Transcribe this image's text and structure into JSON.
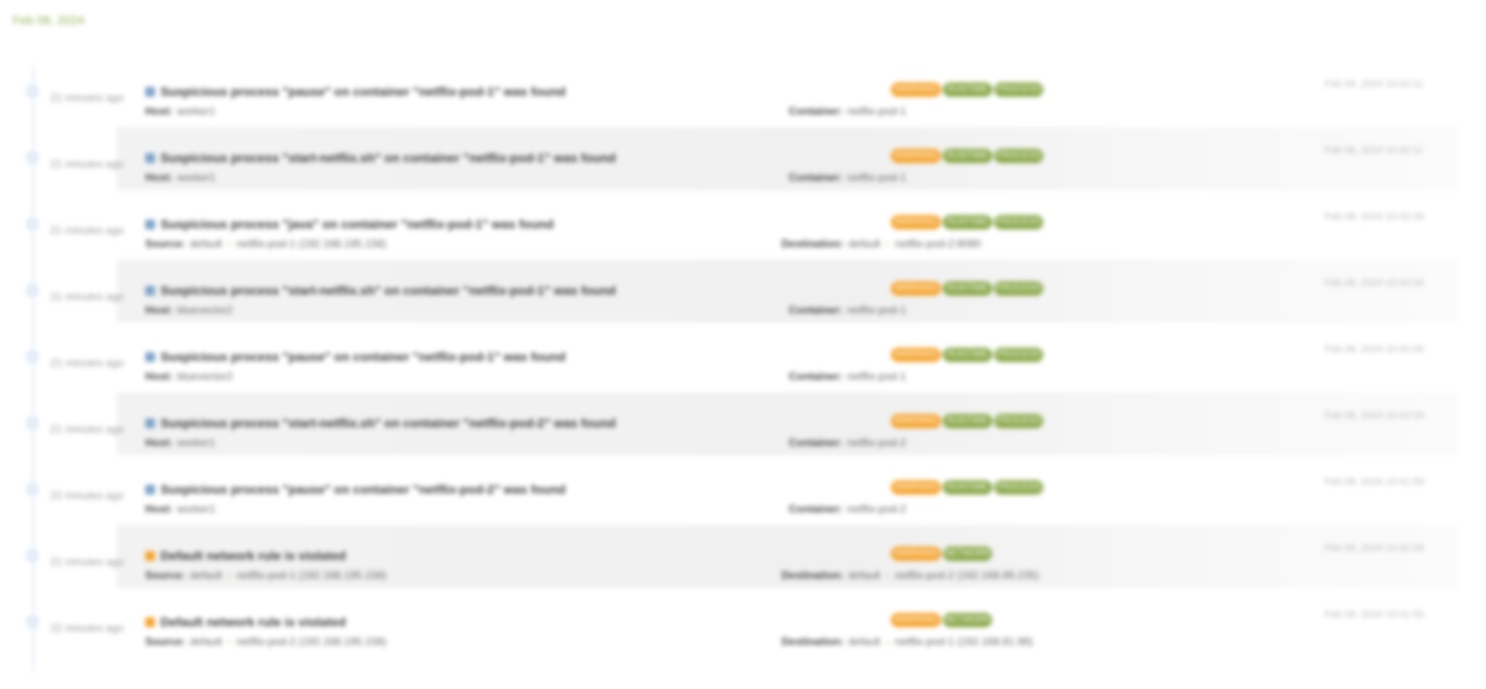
{
  "header": {
    "date": "Feb 08, 2024"
  },
  "colors": {
    "accent_green": "#8aa84a",
    "accent_orange": "#f5a531",
    "timeline": "#dfe9f5"
  },
  "events": [
    {
      "time_ago": "21 minutes ago",
      "icon": "process-icon",
      "title": "Suspicious process \"pause\" on container \"netflix-pod-1\" was found",
      "sub_label": "Host:",
      "sub_value": "worker1",
      "sub_target": "",
      "dest_label": "Container:",
      "dest_value": "netflix-pod-1",
      "dest_target": "",
      "tags": [
        {
          "text": "WARNING",
          "color": "orange"
        },
        {
          "text": "RUNTIME",
          "color": "green"
        },
        {
          "text": "PROCESS",
          "color": "green"
        }
      ],
      "timestamp": "Feb 08, 2024 10:42:11"
    },
    {
      "time_ago": "21 minutes ago",
      "icon": "process-icon",
      "title": "Suspicious process \"start-netflix.sh\" on container \"netflix-pod-1\" was found",
      "sub_label": "Host:",
      "sub_value": "worker1",
      "sub_target": "",
      "dest_label": "Container:",
      "dest_value": "netflix-pod-1",
      "dest_target": "",
      "tags": [
        {
          "text": "WARNING",
          "color": "orange"
        },
        {
          "text": "RUNTIME",
          "color": "green"
        },
        {
          "text": "PROCESS",
          "color": "green"
        }
      ],
      "timestamp": "Feb 08, 2024 10:42:11"
    },
    {
      "time_ago": "21 minutes ago",
      "icon": "process-icon",
      "title": "Suspicious process \"java\" on container \"netflix-pod-1\" was found",
      "sub_label": "Source:",
      "sub_value": "default",
      "sub_target": "netflix-pod-1 (192.168.195.158)",
      "dest_label": "Destination:",
      "dest_value": "default",
      "dest_target": "netflix-pod-2:8080",
      "tags": [
        {
          "text": "WARNING",
          "color": "orange"
        },
        {
          "text": "RUNTIME",
          "color": "green"
        },
        {
          "text": "PROCESS",
          "color": "green"
        }
      ],
      "timestamp": "Feb 08, 2024 10:42:09"
    },
    {
      "time_ago": "21 minutes ago",
      "icon": "process-icon",
      "title": "Suspicious process \"start-netflix.sh\" on container \"netflix-pod-1\" was found",
      "sub_label": "Host:",
      "sub_value": "bluevector2",
      "sub_target": "",
      "dest_label": "Container:",
      "dest_value": "netflix-pod-1",
      "dest_target": "",
      "tags": [
        {
          "text": "WARNING",
          "color": "orange"
        },
        {
          "text": "RUNTIME",
          "color": "green"
        },
        {
          "text": "PROCESS",
          "color": "green"
        }
      ],
      "timestamp": "Feb 08, 2024 10:42:06"
    },
    {
      "time_ago": "21 minutes ago",
      "icon": "process-icon",
      "title": "Suspicious process \"pause\" on container \"netflix-pod-1\" was found",
      "sub_label": "Host:",
      "sub_value": "bluevector2",
      "sub_target": "",
      "dest_label": "Container:",
      "dest_value": "netflix-pod-1",
      "dest_target": "",
      "tags": [
        {
          "text": "WARNING",
          "color": "orange"
        },
        {
          "text": "RUNTIME",
          "color": "green"
        },
        {
          "text": "PROCESS",
          "color": "green"
        }
      ],
      "timestamp": "Feb 08, 2024 10:42:06"
    },
    {
      "time_ago": "21 minutes ago",
      "icon": "process-icon",
      "title": "Suspicious process \"start-netflix.sh\" on container \"netflix-pod-2\" was found",
      "sub_label": "Host:",
      "sub_value": "worker1",
      "sub_target": "",
      "dest_label": "Container:",
      "dest_value": "netflix-pod-2",
      "dest_target": "",
      "tags": [
        {
          "text": "WARNING",
          "color": "orange"
        },
        {
          "text": "RUNTIME",
          "color": "green"
        },
        {
          "text": "PROCESS",
          "color": "green"
        }
      ],
      "timestamp": "Feb 08, 2024 10:42:03"
    },
    {
      "time_ago": "22 minutes ago",
      "icon": "process-icon",
      "title": "Suspicious process \"pause\" on container \"netflix-pod-2\" was found",
      "sub_label": "Host:",
      "sub_value": "worker1",
      "sub_target": "",
      "dest_label": "Container:",
      "dest_value": "netflix-pod-2",
      "dest_target": "",
      "tags": [
        {
          "text": "WARNING",
          "color": "orange"
        },
        {
          "text": "RUNTIME",
          "color": "green"
        },
        {
          "text": "PROCESS",
          "color": "green"
        }
      ],
      "timestamp": "Feb 08, 2024 10:41:59"
    },
    {
      "time_ago": "21 minutes ago",
      "icon": "network-icon",
      "title": "Default network rule is violated",
      "sub_label": "Source:",
      "sub_value": "default",
      "sub_target": "netflix-pod-1 (192.168.195.158)",
      "dest_label": "Destination:",
      "dest_value": "default",
      "dest_target": "netflix-pod-2 (192.168.89.235)",
      "tags": [
        {
          "text": "WARNING",
          "color": "orange"
        },
        {
          "text": "NETWORK",
          "color": "green"
        }
      ],
      "timestamp": "Feb 08, 2024 10:42:09"
    },
    {
      "time_ago": "22 minutes ago",
      "icon": "network-icon",
      "title": "Default network rule is violated",
      "sub_label": "Source:",
      "sub_value": "default",
      "sub_target": "netflix-pod-2 (192.168.195.158)",
      "dest_label": "Destination:",
      "dest_value": "default",
      "dest_target": "netflix-pod-1 (192.168.81.98)",
      "tags": [
        {
          "text": "WARNING",
          "color": "orange"
        },
        {
          "text": "NETWORK",
          "color": "green"
        }
      ],
      "timestamp": "Feb 08, 2024 10:41:55"
    }
  ]
}
